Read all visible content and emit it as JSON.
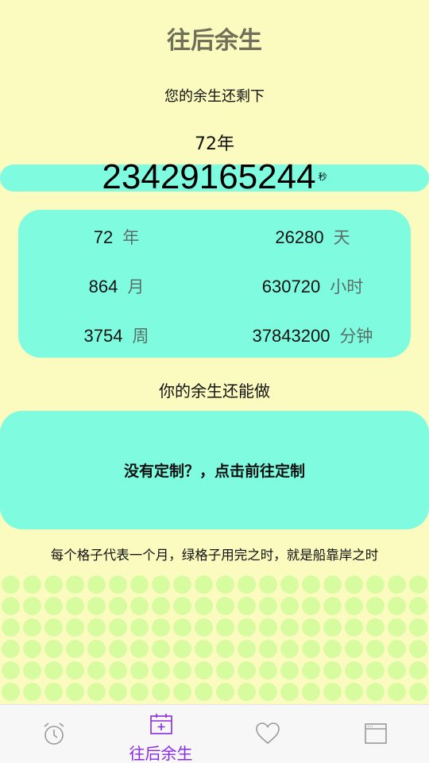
{
  "header": {
    "title": "往后余生"
  },
  "remaining": {
    "subtitle": "您的余生还剩下",
    "years_text": "72年",
    "seconds": "23429165244",
    "seconds_unit": "秒"
  },
  "stats": {
    "left": [
      {
        "value": "72",
        "unit": "年"
      },
      {
        "value": "864",
        "unit": "月"
      },
      {
        "value": "3754",
        "unit": "周"
      }
    ],
    "right": [
      {
        "value": "26280",
        "unit": "天"
      },
      {
        "value": "630720",
        "unit": "小时"
      },
      {
        "value": "37843200",
        "unit": "分钟"
      }
    ]
  },
  "todo": {
    "section_title": "你的余生还能做",
    "cta_text": "没有定制？，点击前往定制"
  },
  "grid": {
    "caption": "每个格子代表一个月，绿格子用完之时，就是船靠岸之时",
    "dot_color": "#d7fca0"
  },
  "colors": {
    "background": "#fbfbbf",
    "card": "#7ffce0",
    "active_tab": "#8a2be2"
  },
  "tabbar": {
    "tabs": [
      {
        "icon": "alarm-clock-icon",
        "active": false
      },
      {
        "icon": "calendar-plus-icon",
        "label": "往后余生",
        "active": true
      },
      {
        "icon": "heart-icon",
        "active": false
      },
      {
        "icon": "window-icon",
        "active": false
      }
    ]
  }
}
